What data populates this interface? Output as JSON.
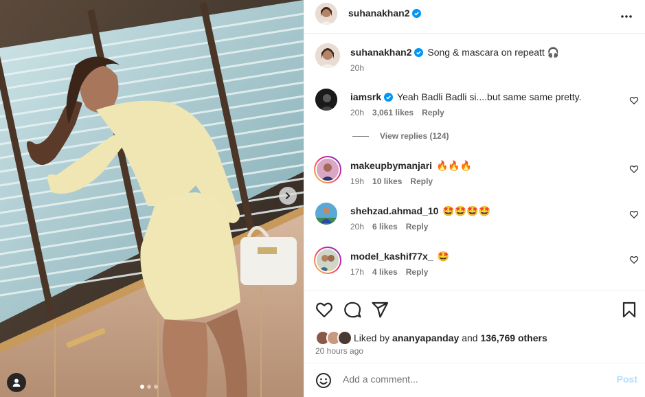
{
  "post": {
    "username": "suhanakhan2",
    "verified": true,
    "caption": "Song & mascara on repeatt 🎧",
    "caption_time": "20h"
  },
  "comments": [
    {
      "username": "iamsrk",
      "verified": true,
      "text": "Yeah Badli Badli si....but same same pretty.",
      "time": "20h",
      "likes": "3,061 likes",
      "reply": "Reply",
      "view_replies": "View replies (124)"
    },
    {
      "username": "makeupbymanjari",
      "verified": false,
      "text": "🔥🔥🔥",
      "time": "19h",
      "likes": "10 likes",
      "reply": "Reply"
    },
    {
      "username": "shehzad.ahmad_10",
      "verified": false,
      "text": "🤩🤩🤩🤩",
      "time": "20h",
      "likes": "6 likes",
      "reply": "Reply"
    },
    {
      "username": "model_kashif77x_",
      "verified": false,
      "text": "🤩",
      "time": "17h",
      "likes": "4 likes",
      "reply": "Reply"
    }
  ],
  "likes": {
    "prefix": "Liked by",
    "user": "ananyapanday",
    "and": "and",
    "count": "136,769 others"
  },
  "posted": "20 hours ago",
  "composer": {
    "placeholder": "Add a comment...",
    "post_label": "Post"
  },
  "carousel": {
    "total": 3,
    "active": 1
  },
  "colors": {
    "verified": "#0095f6",
    "post_disabled": "#b2dffc",
    "muted": "#737373",
    "outfit": "#efe6b4"
  },
  "icons": [
    "more-icon",
    "heart-icon",
    "comment-icon",
    "share-icon",
    "save-icon",
    "emoji-icon",
    "chevron-right-icon",
    "user-tag-icon",
    "verified-icon"
  ]
}
